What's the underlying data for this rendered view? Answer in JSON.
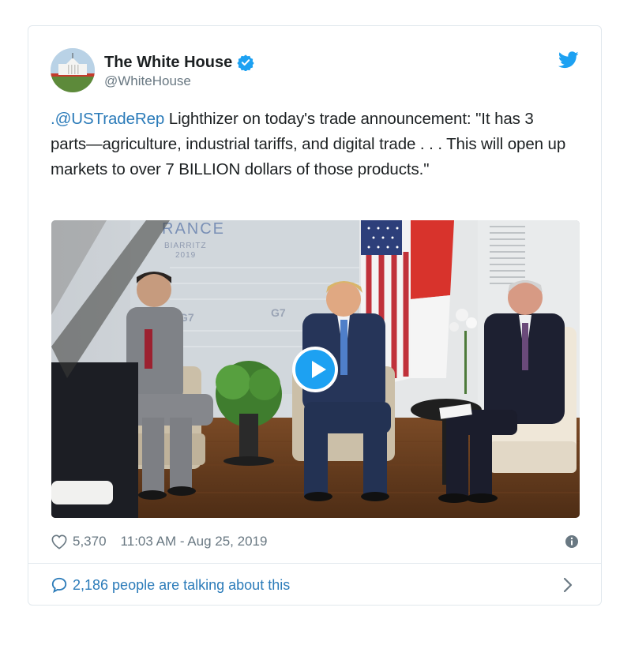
{
  "author": {
    "name": "The White House",
    "handle": "@WhiteHouse",
    "avatar_icon": "white-house-avatar",
    "verified_icon": "verified-badge-icon"
  },
  "brand": {
    "icon": "twitter-bird-icon",
    "color": "#1da1f2"
  },
  "tweet": {
    "mention": ".@USTradeRep",
    "text": " Lighthizer on today's trade announcement: \"It has 3 parts—agriculture, industrial tariffs, and digital trade . . . This will open up markets to over 7 BILLION dollars of those products.\""
  },
  "media": {
    "type": "video",
    "backdrop_text": {
      "country": "RANCE",
      "city": "BIARRITZ",
      "year": "2019",
      "summit": "G7"
    },
    "play_icon": "play-icon"
  },
  "meta": {
    "heart_icon": "heart-icon",
    "likes": "5,370",
    "timestamp": "11:03 AM - Aug 25, 2019",
    "info_icon": "info-icon"
  },
  "conversation": {
    "icon": "speech-bubble-icon",
    "label": "2,186 people are talking about this",
    "chevron_icon": "chevron-right-icon"
  },
  "colors": {
    "link": "#2b7bb9",
    "muted": "#697882",
    "border": "#e1e8ed"
  }
}
